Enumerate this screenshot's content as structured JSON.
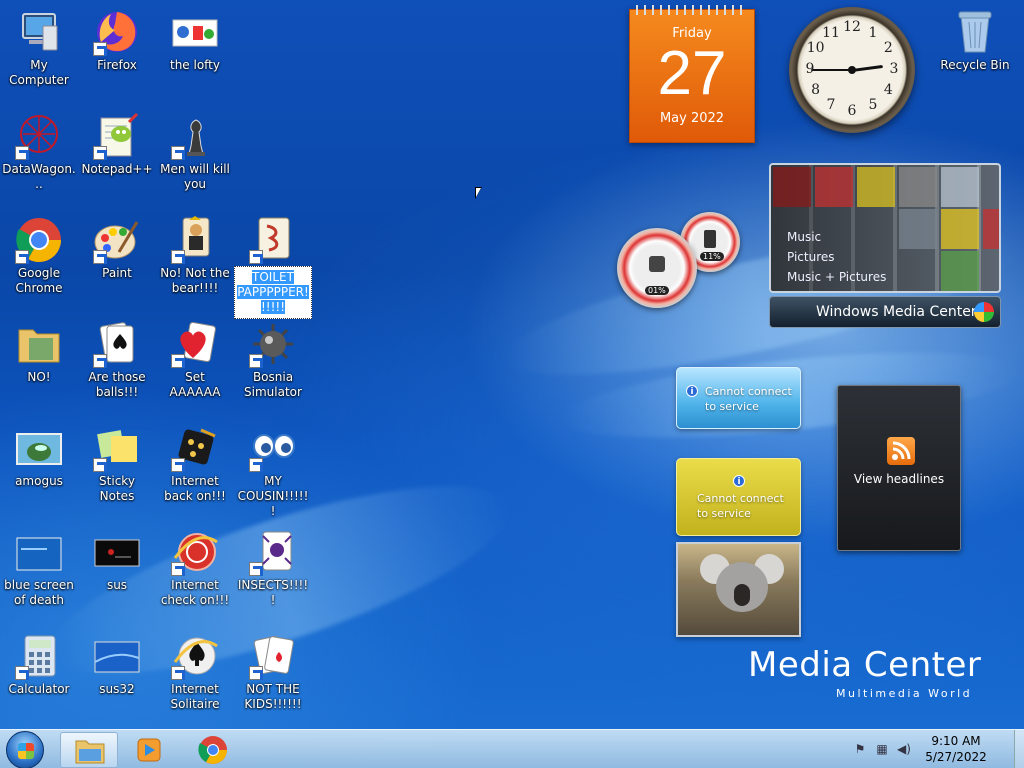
{
  "desktop_icons": [
    {
      "label": "My Computer",
      "icon": "computer-icon",
      "shortcut": false
    },
    {
      "label": "Firefox",
      "icon": "firefox-icon",
      "shortcut": true
    },
    {
      "label": "the lofty",
      "icon": "image-file-icon",
      "shortcut": false
    },
    {
      "label": "DataWagon...",
      "icon": "datawagon-icon",
      "shortcut": true
    },
    {
      "label": "Notepad++",
      "icon": "notepadpp-icon",
      "shortcut": true
    },
    {
      "label": "Men will kill you",
      "icon": "chess-icon",
      "shortcut": true
    },
    {
      "label": "Google Chrome",
      "icon": "chrome-icon",
      "shortcut": true
    },
    {
      "label": "Paint",
      "icon": "paint-icon",
      "shortcut": true
    },
    {
      "label": "No! Not the bear!!!!",
      "icon": "cards-icon",
      "shortcut": true
    },
    {
      "label": "TOILET PAPPPPPER!!!!!!",
      "icon": "mahjong-icon",
      "shortcut": true,
      "selected": true
    },
    {
      "label": "NO!",
      "icon": "folder-icon",
      "shortcut": false
    },
    {
      "label": "Are those balls!!!",
      "icon": "solitaire-icon",
      "shortcut": true
    },
    {
      "label": "Set AAAAAA",
      "icon": "hearts-icon",
      "shortcut": true
    },
    {
      "label": "Bosnia Simulator",
      "icon": "minesweeper-icon",
      "shortcut": true
    },
    {
      "label": "amogus",
      "icon": "image-file-icon",
      "shortcut": false
    },
    {
      "label": "Sticky Notes",
      "icon": "sticky-notes-icon",
      "shortcut": true
    },
    {
      "label": "Internet back on!!!",
      "icon": "backgammon-icon",
      "shortcut": true
    },
    {
      "label": "MY COUSIN!!!!!!",
      "icon": "eyes-icon",
      "shortcut": true
    },
    {
      "label": "blue screen of death",
      "icon": "image-file-icon",
      "shortcut": false
    },
    {
      "label": "sus",
      "icon": "image-file-icon",
      "shortcut": false
    },
    {
      "label": "Internet check on!!!",
      "icon": "internet-checkers-icon",
      "shortcut": true
    },
    {
      "label": "INSECTS!!!!!",
      "icon": "spider-solitaire-icon",
      "shortcut": true
    },
    {
      "label": "Calculator",
      "icon": "calculator-icon",
      "shortcut": true
    },
    {
      "label": "sus32",
      "icon": "image-file-icon",
      "shortcut": false
    },
    {
      "label": "Internet Solitaire",
      "icon": "internet-spades-icon",
      "shortcut": true
    },
    {
      "label": "NOT THE KIDS!!!!!!",
      "icon": "freecell-icon",
      "shortcut": true
    },
    {
      "label": "Recycle Bin",
      "icon": "recycle-bin-icon",
      "shortcut": false
    }
  ],
  "calendar": {
    "weekday": "Friday",
    "day": "27",
    "month_year": "May 2022"
  },
  "clock_gadget": {
    "numbers": [
      "12",
      "1",
      "2",
      "3",
      "4",
      "5",
      "6",
      "7",
      "8",
      "9",
      "10",
      "11"
    ],
    "hour": 2,
    "minute": 45
  },
  "cpu_meter": {
    "cpu": "01%",
    "memory": "11%"
  },
  "media_center_gadget": {
    "menu": [
      "Music",
      "Pictures",
      "Music + Pictures"
    ],
    "bar_label": "Windows Media Center"
  },
  "weather": [
    {
      "message": "Cannot connect to service"
    },
    {
      "message": "Cannot connect to service"
    }
  ],
  "news": {
    "label": "View headlines"
  },
  "branding": {
    "title": "Media Center",
    "subtitle": "Multimedia World"
  },
  "taskbar": {
    "buttons": [
      "start-orb",
      "explorer",
      "media-player",
      "chrome"
    ],
    "time": "9:10 AM",
    "date": "5/27/2022"
  },
  "colors": {
    "calendar": "#e86a10",
    "desktop": "#0d4fb5",
    "taskbar": "#b8d5ee"
  }
}
